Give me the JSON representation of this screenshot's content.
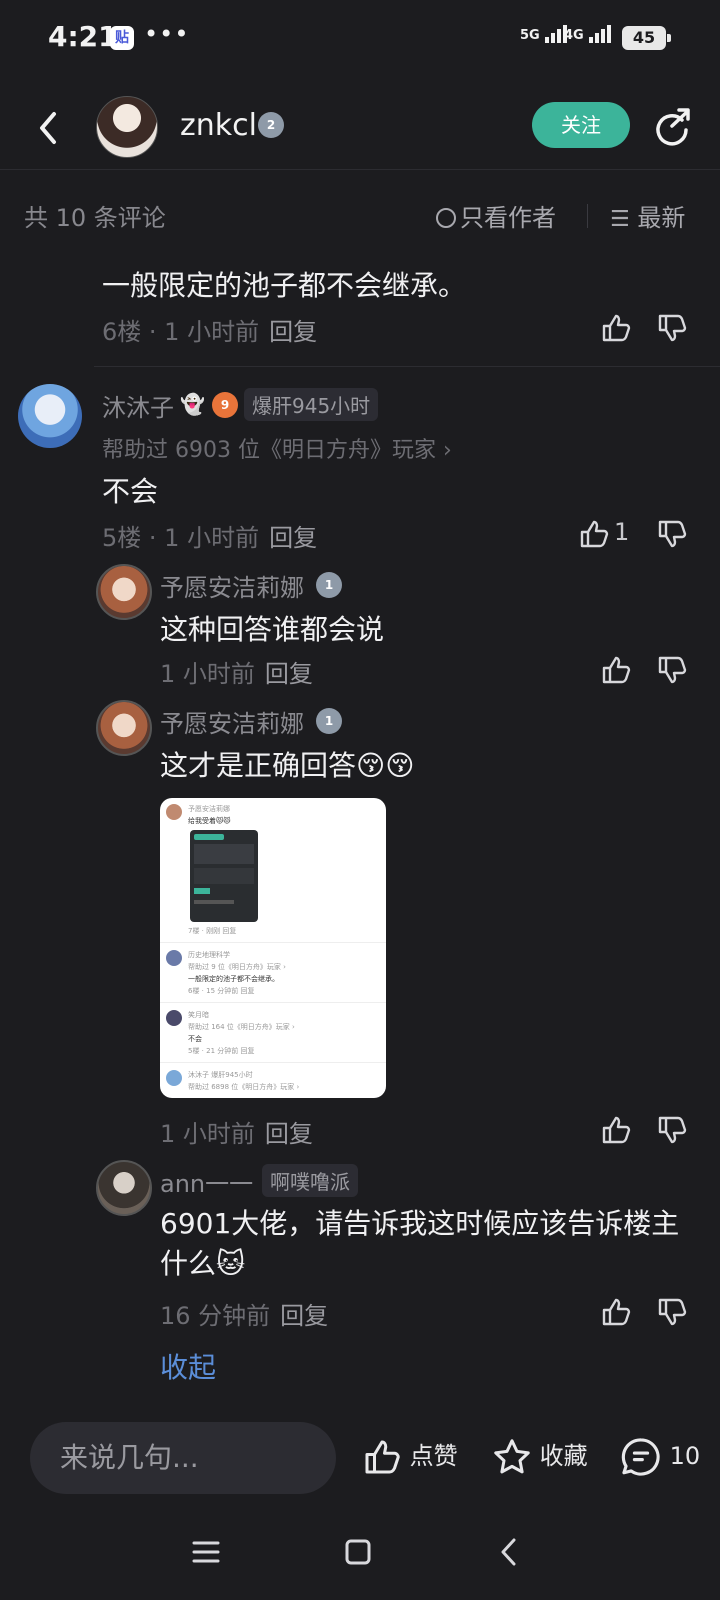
{
  "status_bar": {
    "time": "4:21",
    "app_badge": "贴",
    "dots": "•••",
    "net1": "5G",
    "net2": "4G",
    "battery": "45"
  },
  "header": {
    "username": "znkcl",
    "level": "2",
    "follow_label": "关注"
  },
  "filter": {
    "count_label": "共 10 条评论",
    "only_author_label": "只看作者",
    "sort_label": "最新"
  },
  "comments": [
    {
      "text": "一般限定的池子都不会继承。",
      "floor": "6楼",
      "time": "1 小时前",
      "reply": "回复"
    },
    {
      "name": "沐沐子",
      "level": "9",
      "badge": "爆肝945小时",
      "helped": "帮助过 6903 位《明日方舟》玩家 ›",
      "text": "不会",
      "floor": "5楼",
      "time": "1 小时前",
      "reply": "回复",
      "likes": "1",
      "replies": [
        {
          "name": "予愿安洁莉娜",
          "level": "1",
          "text": "这种回答谁都会说",
          "time": "1 小时前",
          "reply": "回复"
        },
        {
          "name": "予愿安洁莉娜",
          "level": "1",
          "text": "这才是正确回答😚😚",
          "time": "1 小时前",
          "reply": "回复"
        },
        {
          "name": "ann一一",
          "badge": "啊噗噜派",
          "text": "6901大佬，请告诉我这时候应该告诉楼主什么🐱",
          "time": "16 分钟前",
          "reply": "回复"
        }
      ],
      "collapse_label": "收起"
    }
  ],
  "embedded_screenshot": {
    "l1": "予愿安洁莉娜",
    "l2": "给我受着😾😾",
    "l3": "7楼 · 刚刚  回复",
    "l4": "历史地理科学",
    "l5": "帮助过 9 位《明日方舟》玩家 ›",
    "l6": "一般限定的池子都不会继承。",
    "l7": "6楼 · 15 分钟前  回复",
    "l8": "笑月暗",
    "l9": "帮助过 164 位《明日方舟》玩家 ›",
    "l10": "不会",
    "l11": "5楼 · 21 分钟前  回复",
    "l12": "沐沐子",
    "l13": "爆肝945小时",
    "l14": "帮助过 6898 位《明日方舟》玩家 ›"
  },
  "bottom": {
    "input_placeholder": "来说几句...",
    "like_label": "点赞",
    "fav_label": "收藏",
    "comment_count": "10"
  },
  "colors": {
    "bg": "#1c1c1f",
    "accent": "#3cb49a",
    "link": "#5b8ed9"
  }
}
